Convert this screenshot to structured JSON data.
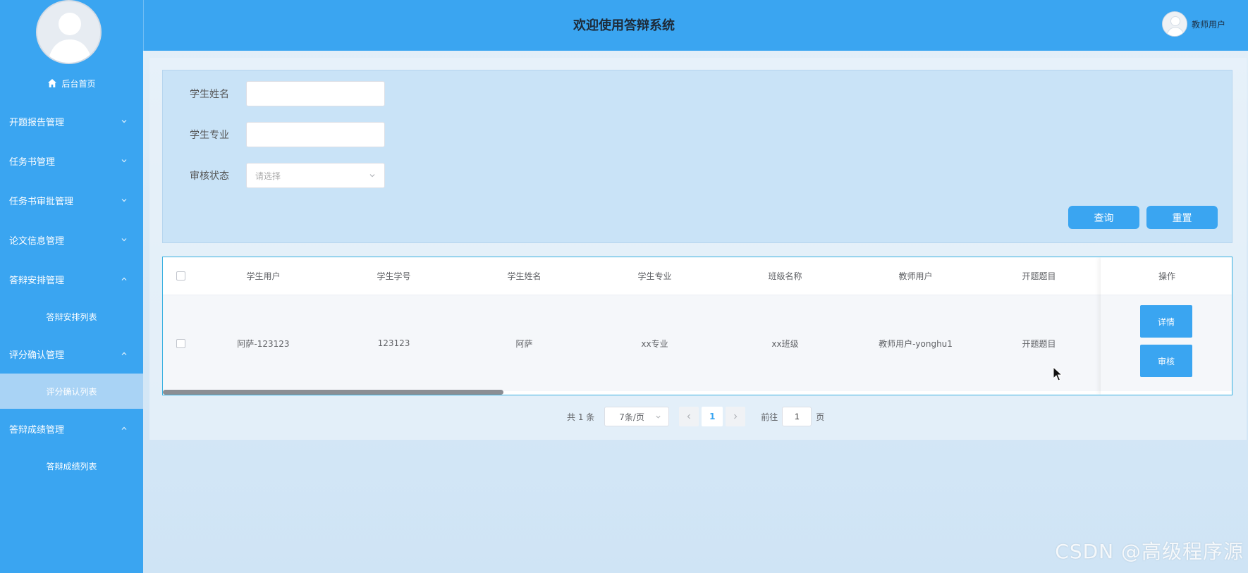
{
  "app": {
    "title": "欢迎使用答辩系统"
  },
  "user": {
    "name": "教师用户"
  },
  "sidebar": {
    "home": "后台首页",
    "groups": [
      {
        "label": "开题报告管理",
        "expanded": false
      },
      {
        "label": "任务书管理",
        "expanded": false
      },
      {
        "label": "任务书审批管理",
        "expanded": false
      },
      {
        "label": "论文信息管理",
        "expanded": false
      },
      {
        "label": "答辩安排管理",
        "expanded": true,
        "sub": "答辩安排列表"
      },
      {
        "label": "评分确认管理",
        "expanded": true,
        "sub": "评分确认列表",
        "active": true
      },
      {
        "label": "答辩成绩管理",
        "expanded": true,
        "sub": "答辩成绩列表"
      }
    ]
  },
  "search": {
    "name_label": "学生姓名",
    "name_value": "",
    "major_label": "学生专业",
    "major_value": "",
    "status_label": "审核状态",
    "status_placeholder": "请选择",
    "query_btn": "查询",
    "reset_btn": "重置"
  },
  "table": {
    "headers": [
      "学生用户",
      "学生学号",
      "学生姓名",
      "学生专业",
      "班级名称",
      "教师用户",
      "开题题目",
      "操作"
    ],
    "rows": [
      [
        "阿萨-123123",
        "123123",
        "阿萨",
        "xx专业",
        "xx班级",
        "教师用户-yonghu1",
        "开题题目"
      ]
    ],
    "actions": {
      "detail": "详情",
      "audit": "审核"
    }
  },
  "pagination": {
    "total": "共 1 条",
    "page_size": "7条/页",
    "current_page": "1",
    "goto_label": "前往",
    "goto_value": "1",
    "page_unit": "页"
  },
  "watermark": "CSDN @高级程序源",
  "colors": {
    "primary": "#3aa5f1",
    "active_menu": "#a9d3f5"
  }
}
